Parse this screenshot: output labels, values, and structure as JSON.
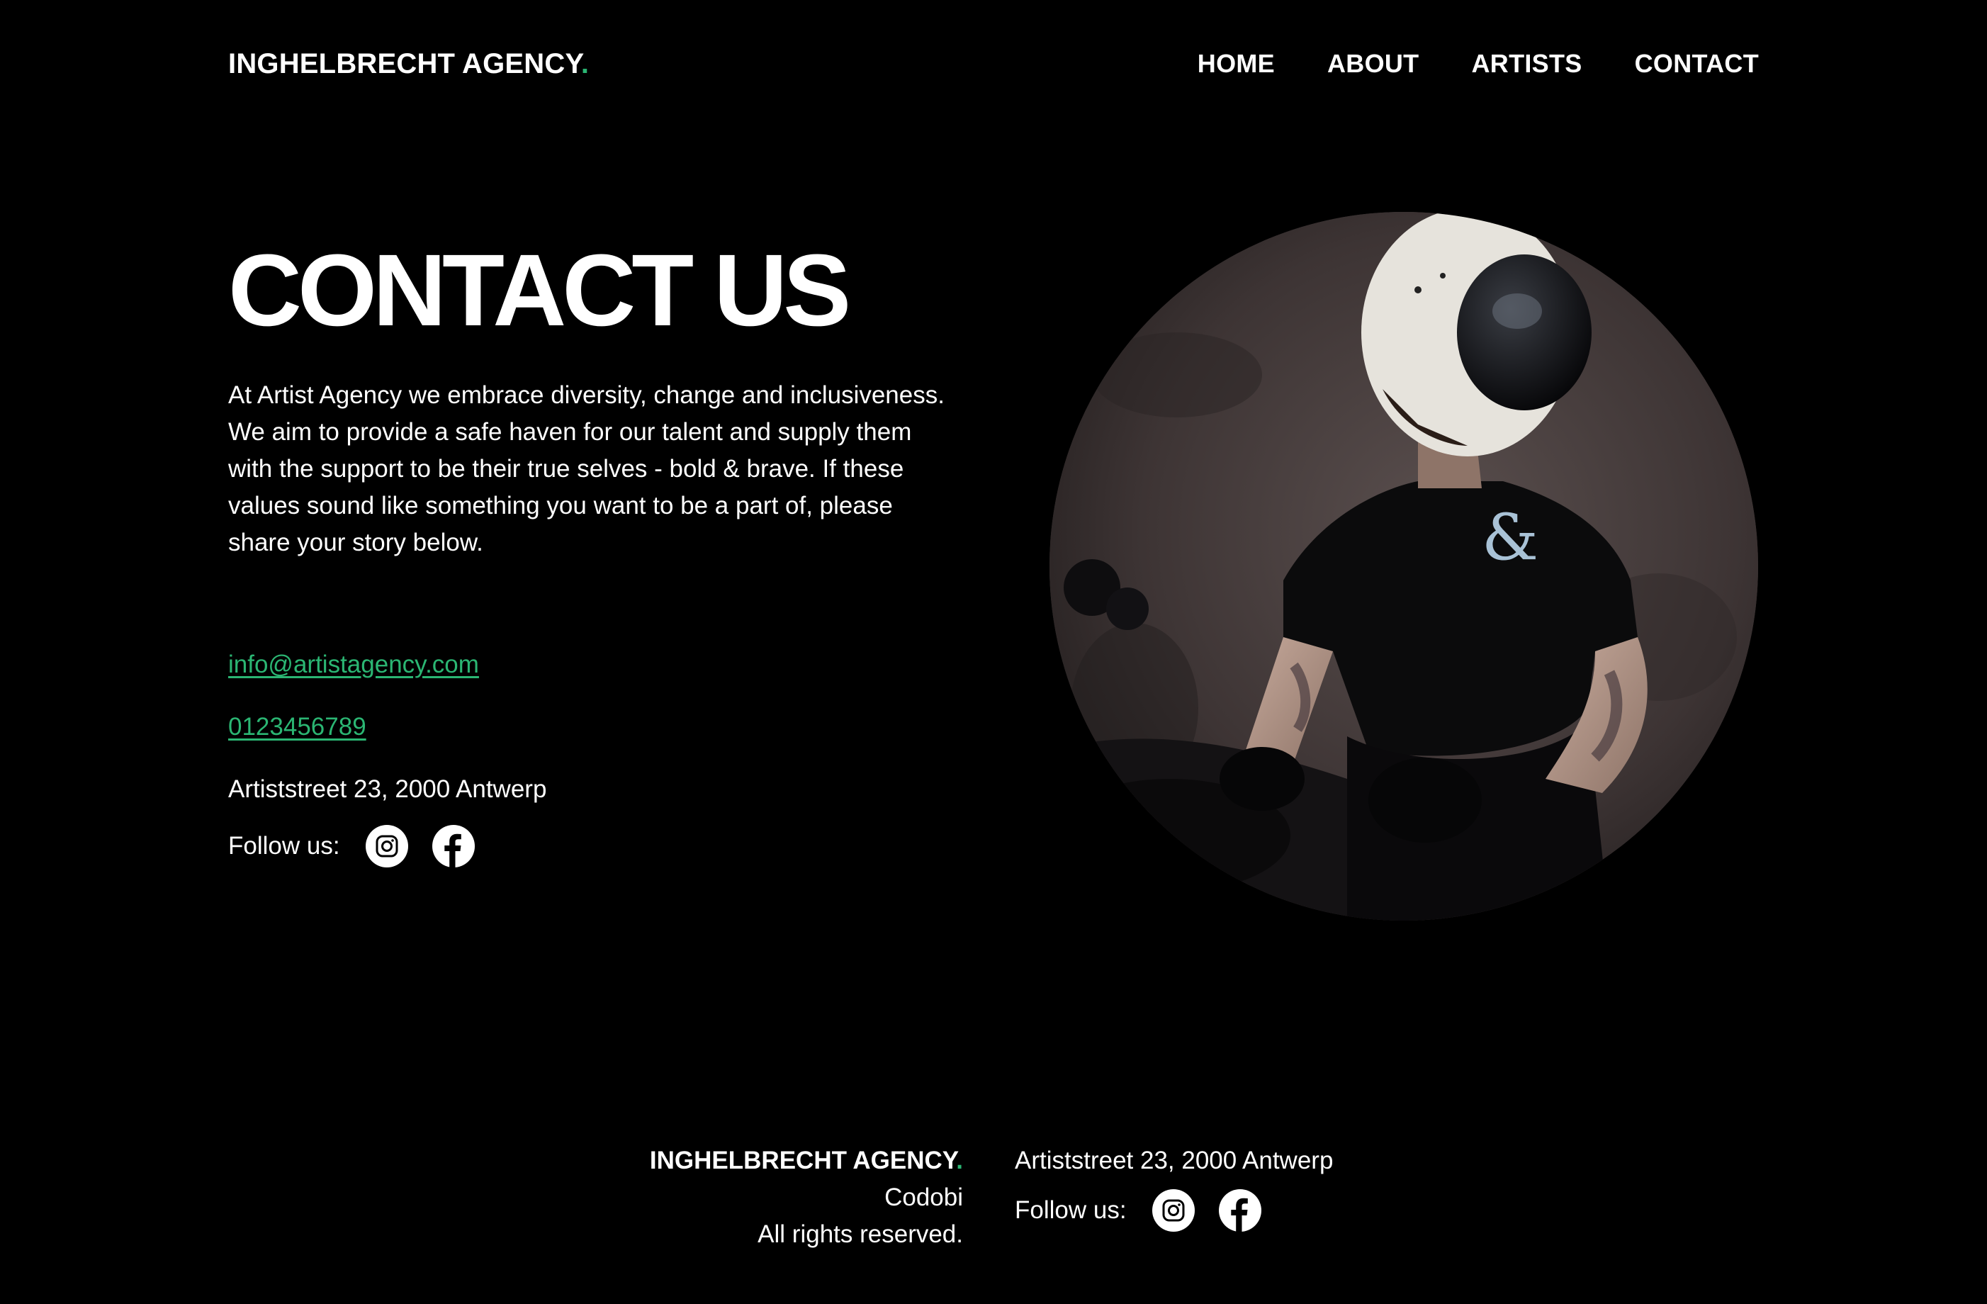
{
  "header": {
    "brand_text": "INGHELBRECHT AGENCY",
    "brand_dot": ".",
    "nav": [
      {
        "label": "HOME"
      },
      {
        "label": "ABOUT"
      },
      {
        "label": "ARTISTS"
      },
      {
        "label": "CONTACT"
      }
    ]
  },
  "hero": {
    "title": "CONTACT US",
    "intro": "At Artist Agency we embrace diversity, change and inclusiveness. We aim to provide a safe haven for our talent and supply them with the support to be their true selves - bold & brave. If these values sound like something you want to be a part of, please share your story below.",
    "email": "info@artistagency.com",
    "phone": "0123456789",
    "address": "Artiststreet 23, 2000 Antwerp",
    "follow_label": "Follow us:"
  },
  "footer": {
    "brand_text": "INGHELBRECHT AGENCY",
    "brand_dot": ".",
    "company": "Codobi",
    "rights": "All rights reserved.",
    "address": "Artiststreet 23, 2000 Antwerp",
    "follow_label": "Follow us:"
  },
  "icons": {
    "instagram": "instagram-icon",
    "facebook": "facebook-icon"
  },
  "colors": {
    "background": "#000000",
    "text": "#ffffff",
    "accent": "#2bb673"
  }
}
